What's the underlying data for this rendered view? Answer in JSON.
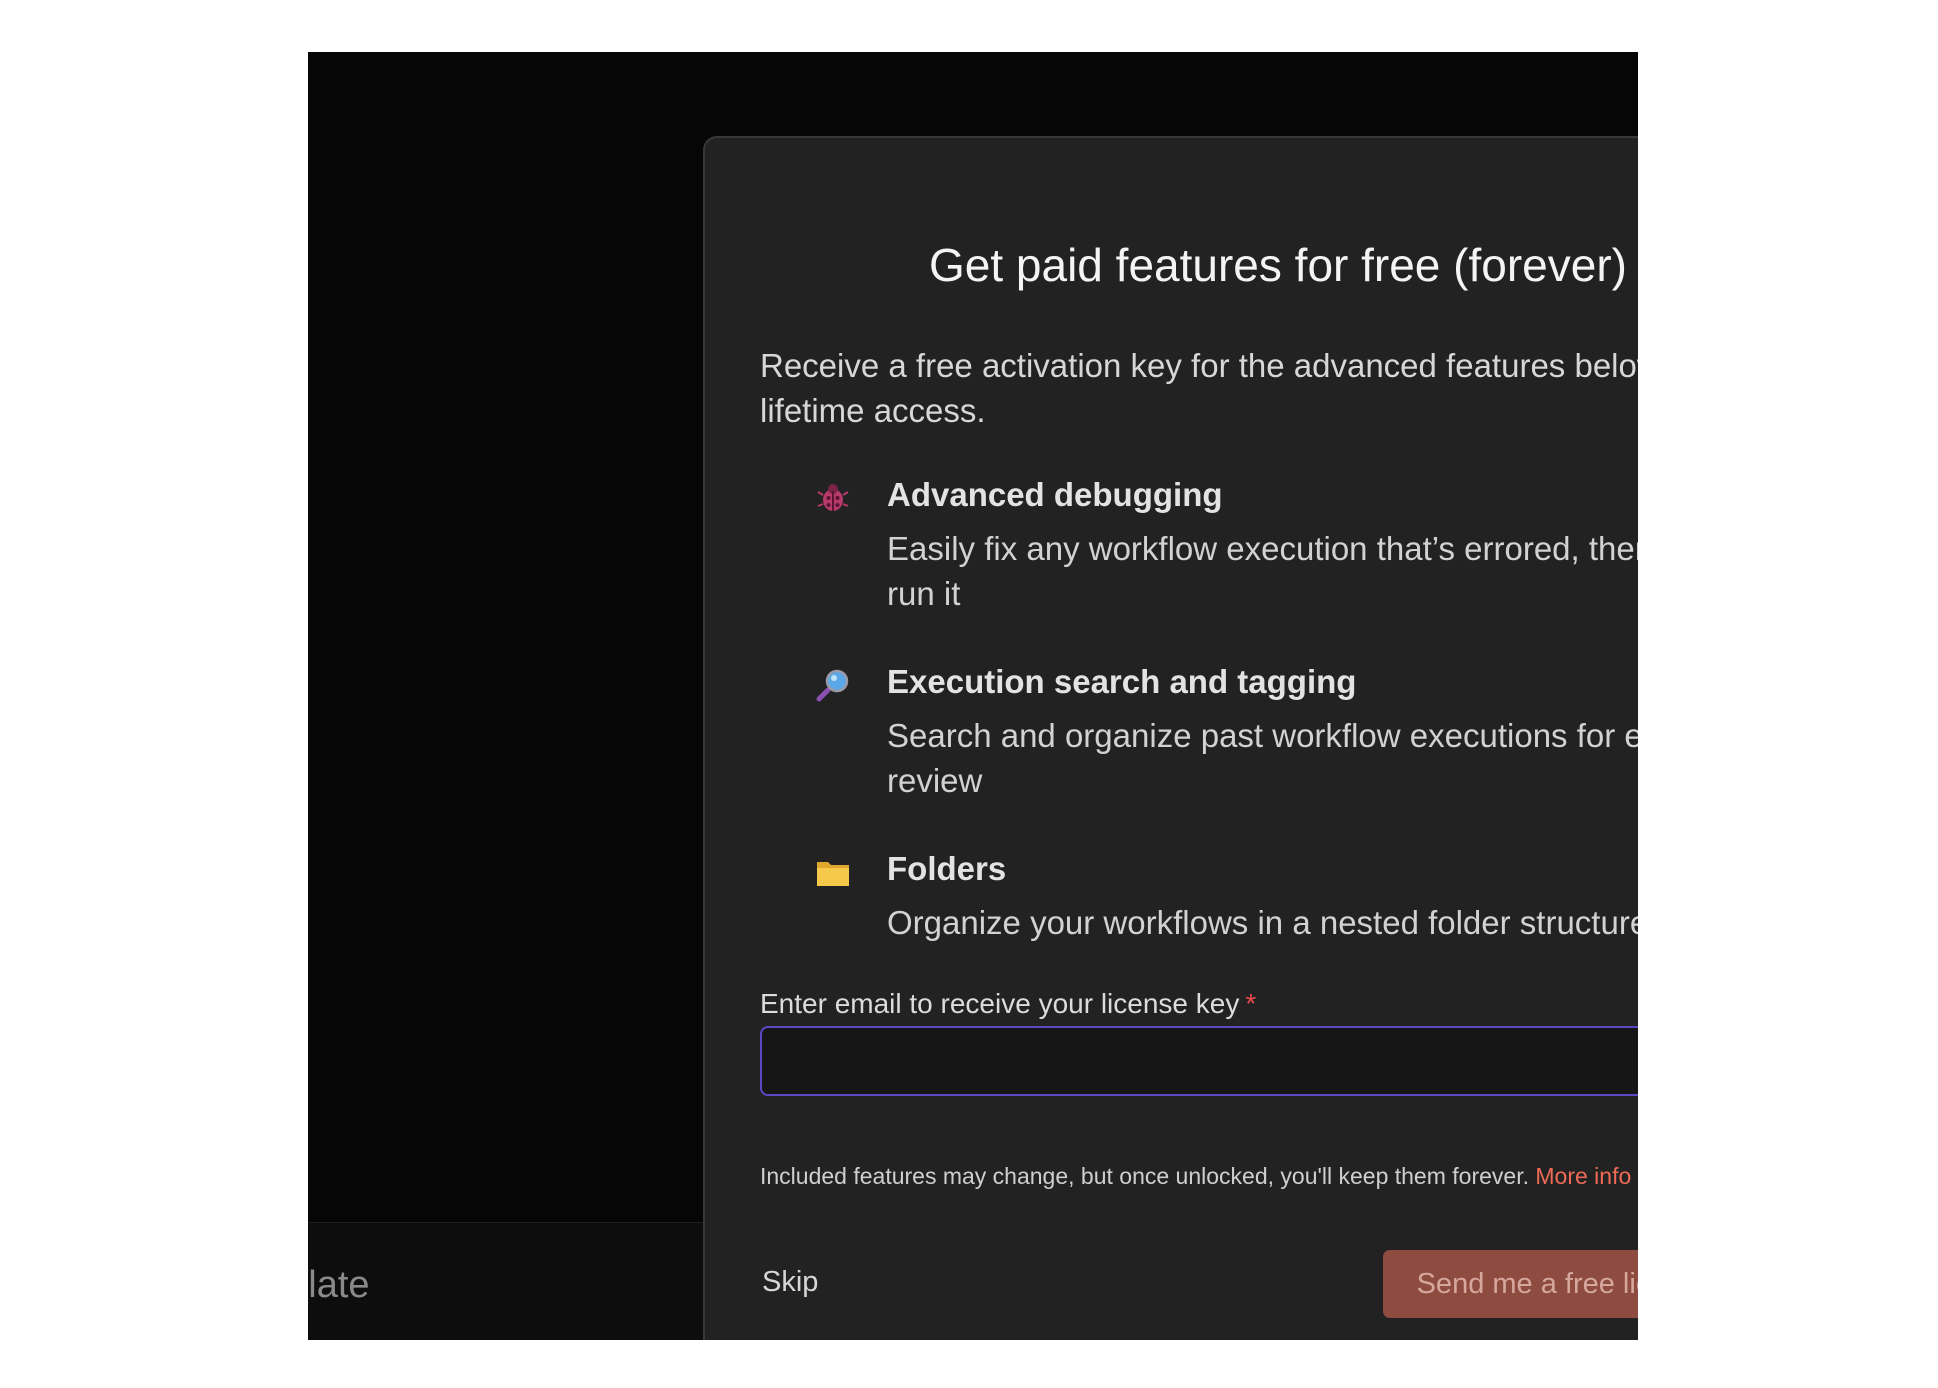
{
  "background": {
    "partial_text": "nplate"
  },
  "modal": {
    "title": "Get paid features for free (forever)",
    "intro": "Receive a free activation key for the advanced features below - lifetime access.",
    "features": [
      {
        "icon": "bug-icon",
        "name": "Advanced debugging",
        "description": "Easily fix any workflow execution that’s errored, then re-run it"
      },
      {
        "icon": "magnifier-icon",
        "name": "Execution search and tagging",
        "description": "Search and organize past workflow executions for easier review"
      },
      {
        "icon": "folder-icon",
        "name": "Folders",
        "description": "Organize your workflows in a nested folder structure"
      }
    ],
    "email_label": "Enter email to receive your license key",
    "required_mark": "*",
    "email_value": "",
    "note": "Included features may change, but once unlocked, you'll keep them forever.",
    "more_info": "More info",
    "skip_label": "Skip",
    "send_label": "Send me a free license key"
  },
  "colors": {
    "accent": "#ef6a54",
    "input_border": "#5a47c2",
    "send_button_bg": "#8e4b3f"
  }
}
